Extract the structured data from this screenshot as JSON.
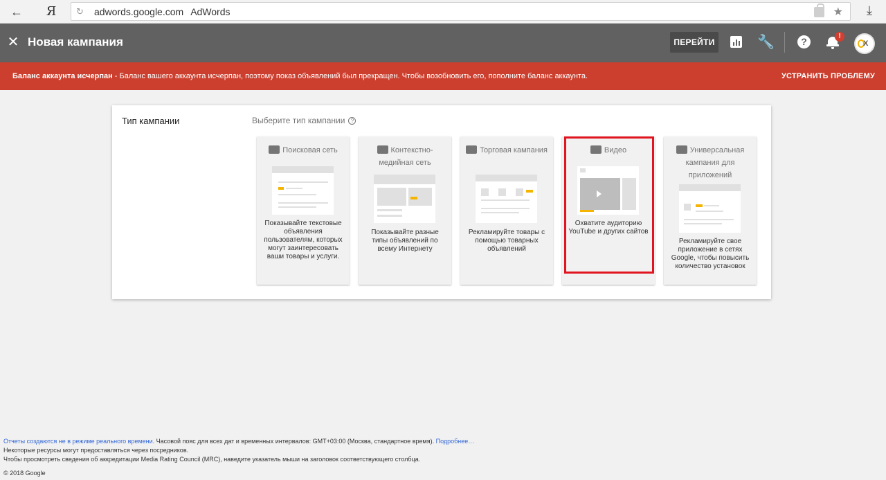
{
  "browser": {
    "url": "adwords.google.com",
    "tab_title": "AdWords",
    "yandex_label": "Я"
  },
  "header": {
    "title": "Новая кампания",
    "goto_button": "ПЕРЕЙТИ",
    "notifications_badge": "!"
  },
  "alert": {
    "strong": "Баланс аккаунта исчерпан",
    "text": " - Баланс вашего аккаунта исчерпан, поэтому показ объявлений был прекращен. Чтобы возобновить его, пополните баланс аккаунта.",
    "action": "УСТРАНИТЬ ПРОБЛЕМУ"
  },
  "campaign": {
    "section_label": "Тип кампании",
    "prompt": "Выберите тип кампании",
    "types": [
      {
        "title": "Поисковая сеть",
        "icon": "search-icon",
        "description": "Показывайте текстовые объявления пользователям, которых могут заинтересовать ваши товары и услуги."
      },
      {
        "title": "Контекстно-медийная сеть",
        "icon": "display-icon",
        "description": "Показывайте разные типы объявлений по всему Интернету"
      },
      {
        "title": "Торговая кампания",
        "icon": "shopping-tag-icon",
        "description": "Рекламируйте товары с помощью товарных объявлений"
      },
      {
        "title": "Видео",
        "icon": "video-camera-icon",
        "description": "Охватите аудиторию YouTube и других сайтов"
      },
      {
        "title": "Универсальная кампания для приложений",
        "icon": "app-icon",
        "description": "Рекламируйте свое приложение в сетях Google, чтобы повысить количество установок"
      }
    ],
    "selected": "Видео"
  },
  "footer": {
    "line1_link": "Отчеты создаются не в режиме реального времени.",
    "line1_text": " Часовой пояс для всех дат и временных интервалов: GMT+03:00 (Москва, стандартное время). ",
    "line1_more": "Подробнее…",
    "line2": "Некоторые ресурсы могут предоставляться через посредников.",
    "line3": "Чтобы просмотреть сведения об аккредитации Media Rating Council (MRC), наведите указатель мыши на заголовок соответствующего столбца.",
    "copyright": "© 2018 Google"
  },
  "colors": {
    "header_bg": "#616161",
    "alert_bg": "#cc3f2e",
    "highlight": "#e0151f",
    "accent_yellow": "#f4b400",
    "link": "#3367d6"
  }
}
